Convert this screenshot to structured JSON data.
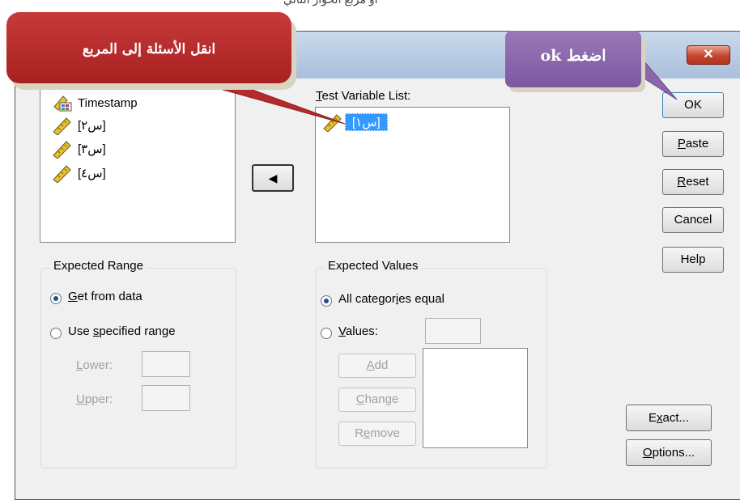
{
  "top_text": "أو مربع الحوار التالي",
  "close_glyph": "✕",
  "source_list": [
    {
      "label": "Timestamp",
      "icon": "nominal-variable-icon"
    },
    {
      "label": "[س٢]",
      "icon": "scale-variable-icon"
    },
    {
      "label": "[س٣]",
      "icon": "scale-variable-icon"
    },
    {
      "label": "[س٤]",
      "icon": "scale-variable-icon"
    }
  ],
  "move_button_glyph": "◀",
  "test_variable_list": {
    "label": "Test Variable List:",
    "items": [
      {
        "label": "[س١]",
        "selected": true
      }
    ]
  },
  "buttons": {
    "ok": "OK",
    "paste": "Paste",
    "reset": "Reset",
    "cancel": "Cancel",
    "help": "Help",
    "exact": "Exact...",
    "options": "Options..."
  },
  "expected_range": {
    "title": "Expected Range",
    "get_from_data": "Get from data",
    "use_specified_range": "Use specified range",
    "lower": "Lower:",
    "upper": "Upper:",
    "selected": "get_from_data"
  },
  "expected_values": {
    "title": "Expected Values",
    "all_categories_equal": "All categories equal",
    "values": "Values:",
    "add": "Add",
    "change": "Change",
    "remove": "Remove",
    "selected": "all_categories_equal"
  },
  "callouts": {
    "red": "انقل الأسئلة إلى المربع",
    "purple": "اضغط ok"
  },
  "colors": {
    "selection": "#3399ff",
    "callout_red": "#b52a2a",
    "callout_purple": "#8a66ad"
  }
}
